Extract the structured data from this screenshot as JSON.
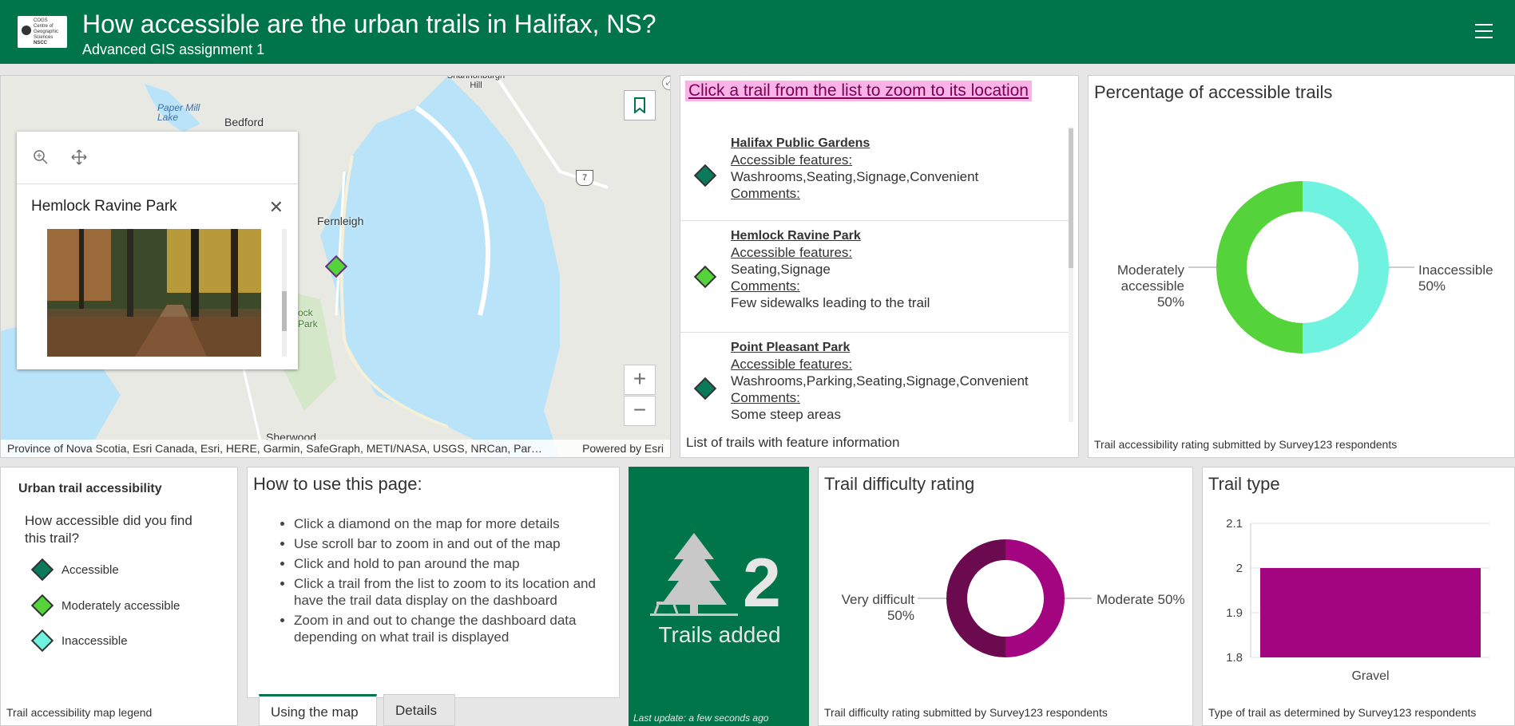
{
  "header": {
    "logo_text": "COGS Centre of Geographic Sciences NSCC",
    "title": "How accessible are the urban trails in Halifax, NS?",
    "subtitle": "Advanced GIS assignment 1",
    "menu_icon": "hamburger-icon"
  },
  "map": {
    "labels": {
      "bedford": "Bedford",
      "fernleigh": "Fernleigh",
      "sherwood": "Sherwood",
      "paper_mill_lake": "Paper Mill Lake",
      "shannon_hill": "Shannonburgh Hill",
      "hemlock_park_short": "ock Park",
      "route": "7"
    },
    "attribution": "Province of Nova Scotia, Esri Canada, Esri, HERE, Garmin, SafeGraph, METI/NASA, USGS, NRCan, Par…",
    "powered_by": "Powered by Esri",
    "zoom_in": "+",
    "zoom_out": "−",
    "popup": {
      "title": "Hemlock Ravine Park",
      "close": "✕"
    }
  },
  "trail_list": {
    "heading": "Click a trail from the list to zoom to its location",
    "items": [
      {
        "name": "Halifax Public Gardens",
        "features_label": "Accessible features:",
        "features": "Washrooms,Seating,Signage,Convenient",
        "comments_label": "Comments:",
        "comments": "",
        "color": "#0b7a5a"
      },
      {
        "name": "Hemlock Ravine Park",
        "features_label": "Accessible features:",
        "features": "Seating,Signage",
        "comments_label": "Comments:",
        "comments": "Few sidewalks leading to the trail",
        "color": "#55d33a"
      },
      {
        "name": "Point Pleasant Park",
        "features_label": "Accessible features:",
        "features": "Washrooms,Parking,Seating,Signage,Convenient",
        "comments_label": "Comments:",
        "comments": "Some steep areas",
        "color": "#0b7a5a"
      }
    ],
    "footer": "List of trails with feature information"
  },
  "accessible_pct": {
    "title": "Percentage of accessible trails",
    "label_left": [
      "Moderately",
      "accessible",
      "50%"
    ],
    "label_right": [
      "Inaccessible",
      "50%"
    ],
    "footer": "Trail accessibility rating submitted by Survey123 respondents"
  },
  "legend": {
    "title": "Urban trail accessibility",
    "question": "How accessible did you find this trail?",
    "items": [
      {
        "label": "Accessible",
        "color": "#0b7a5a"
      },
      {
        "label": "Moderately accessible",
        "color": "#55d33a"
      },
      {
        "label": "Inaccessible",
        "color": "#6ff3e0"
      }
    ],
    "footer": "Trail accessibility map legend"
  },
  "howto": {
    "title": "How to use this page:",
    "bullets": [
      "Click a diamond on the map for more details",
      "Use scroll bar to zoom in and out of the map",
      "Click and hold to pan around the map",
      "Click a trail from the list to zoom to its location and have the trail data display on the dashboard",
      "Zoom in and out to change the dashboard data depending on what trail is displayed"
    ],
    "tabs": [
      "Using the map",
      "Details"
    ]
  },
  "indicator": {
    "value": "2",
    "label": "Trails added",
    "last_update": "Last update: a few seconds ago",
    "icon": "tree-icon"
  },
  "difficulty": {
    "title": "Trail difficulty rating",
    "label_left": [
      "Very difficult",
      "50%"
    ],
    "label_right": "Moderate 50%",
    "footer": "Trail difficulty rating submitted by Survey123 respondents"
  },
  "trail_type": {
    "title": "Trail type",
    "footer": "Type of trail as determined by Survey123 respondents"
  },
  "colors": {
    "brand": "#00754a",
    "moderate_green": "#55d33a",
    "inaccessible_cyan": "#6ff3e0",
    "very_difficult": "#6b0a4f",
    "moderate": "#a2057f",
    "bar": "#a2057f"
  },
  "chart_data": [
    {
      "type": "pie",
      "title": "Percentage of accessible trails",
      "categories": [
        "Inaccessible",
        "Moderately accessible"
      ],
      "values": [
        50,
        50
      ],
      "colors": [
        "#6ff3e0",
        "#55d33a"
      ],
      "donut": true
    },
    {
      "type": "pie",
      "title": "Trail difficulty rating",
      "categories": [
        "Moderate",
        "Very difficult"
      ],
      "values": [
        50,
        50
      ],
      "colors": [
        "#a2057f",
        "#6b0a4f"
      ],
      "donut": true
    },
    {
      "type": "bar",
      "title": "Trail type",
      "categories": [
        "Gravel"
      ],
      "values": [
        2
      ],
      "ylim": [
        1.8,
        2.1
      ],
      "yticks": [
        "2.1",
        "2",
        "1.9",
        "1.8"
      ],
      "grid": true
    }
  ]
}
